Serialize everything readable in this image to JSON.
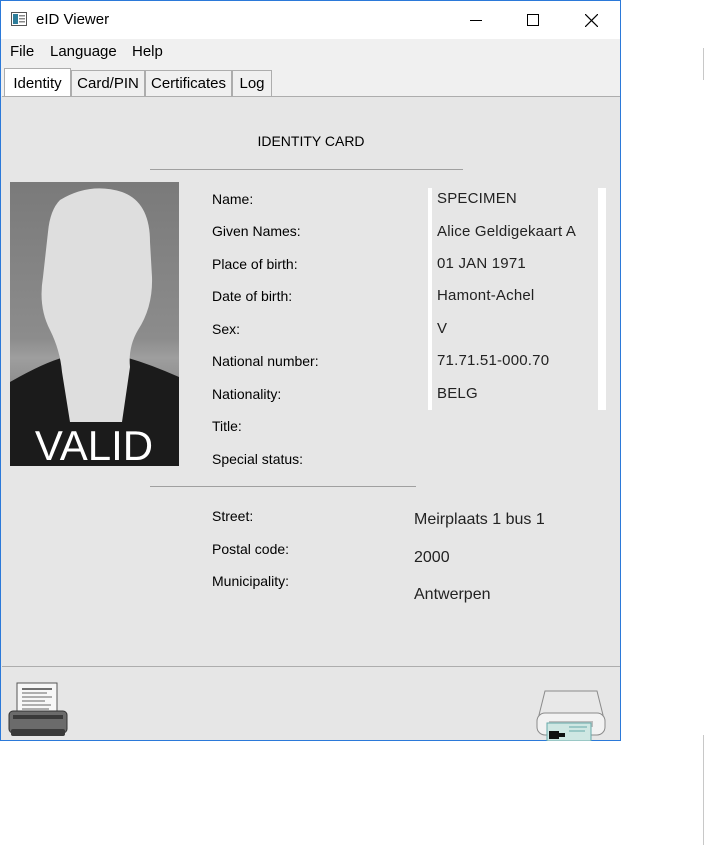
{
  "window": {
    "title": "eID Viewer",
    "controls": {
      "minimize": "—",
      "maximize": "☐",
      "close": "✕"
    }
  },
  "menu": {
    "file": "File",
    "language": "Language",
    "help": "Help"
  },
  "tabs": {
    "identity": "Identity",
    "card_pin": "Card/PIN",
    "certificates": "Certificates",
    "log": "Log",
    "active": "Identity"
  },
  "identity": {
    "heading": "IDENTITY CARD",
    "photo_caption": "VALID",
    "labels": {
      "name": "Name:",
      "given_names": "Given Names:",
      "place_of_birth": "Place of birth:",
      "date_of_birth": "Date of birth:",
      "sex": "Sex:",
      "national_number": "National number:",
      "nationality": "Nationality:",
      "title": "Title:",
      "special_status": "Special status:"
    },
    "values": {
      "name": "SPECIMEN",
      "given_names": "Alice Geldigekaart A",
      "place_of_birth": "01 JAN  1971",
      "date_of_birth": "Hamont-Achel",
      "sex": "V",
      "national_number": "71.71.51-000.70",
      "nationality": "BELG"
    }
  },
  "address": {
    "labels": {
      "street": "Street:",
      "postal_code": "Postal code:",
      "municipality": "Municipality:"
    },
    "values": {
      "street": "Meirplaats 1 bus 1",
      "postal_code": "2000",
      "municipality": "Antwerpen"
    }
  },
  "toolbar": {
    "print_icon": "printer-icon",
    "reader_icon": "card-reader-icon"
  }
}
